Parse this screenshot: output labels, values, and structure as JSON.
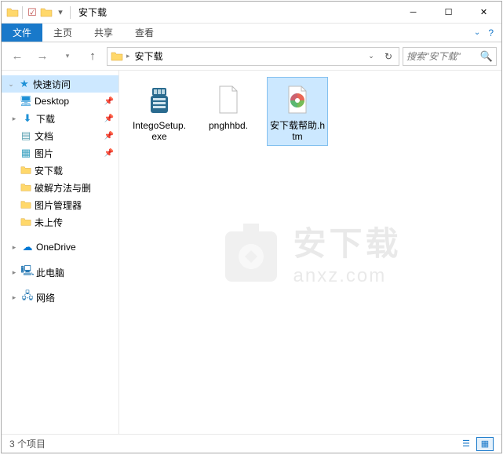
{
  "title": "安下载",
  "ribbon": {
    "file": "文件",
    "home": "主页",
    "share": "共享",
    "view": "查看"
  },
  "nav": {
    "breadcrumb": "安下载"
  },
  "search": {
    "placeholder": "搜索\"安下载\""
  },
  "sidebar": {
    "quickaccess": "快速访问",
    "items": [
      {
        "label": "Desktop",
        "icon": "desktop",
        "pinned": true
      },
      {
        "label": "下载",
        "icon": "downloads",
        "pinned": true
      },
      {
        "label": "文档",
        "icon": "documents",
        "pinned": true
      },
      {
        "label": "图片",
        "icon": "pictures",
        "pinned": true
      },
      {
        "label": "安下载",
        "icon": "folder",
        "pinned": false
      },
      {
        "label": "破解方法与删",
        "icon": "folder",
        "pinned": false
      },
      {
        "label": "图片管理器",
        "icon": "folder",
        "pinned": false
      },
      {
        "label": "未上传",
        "icon": "folder",
        "pinned": false
      }
    ],
    "onedrive": "OneDrive",
    "thispc": "此电脑",
    "network": "网络"
  },
  "files": [
    {
      "name": "IntegoSetup.exe",
      "type": "exe"
    },
    {
      "name": "pnghhbd.",
      "type": "blank"
    },
    {
      "name": "安下载帮助.htm",
      "type": "htm",
      "selected": true
    }
  ],
  "status": {
    "count": "3 个项目"
  },
  "watermark": {
    "cn": "安下载",
    "en": "anxz.com"
  }
}
